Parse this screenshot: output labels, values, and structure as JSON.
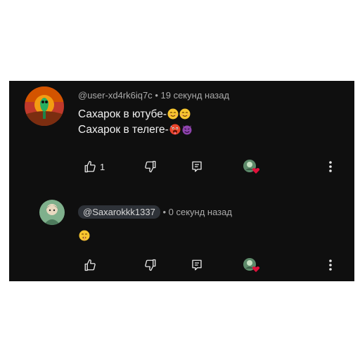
{
  "comments": [
    {
      "author": "@user-xd4rk6iq7c",
      "separator": "•",
      "time": "19 секунд назад",
      "lines": [
        "Сахарок в ютубе-",
        "Сахарок в телеге-"
      ],
      "line_emojis": [
        [
          "smiling-face-emoji",
          "smiling-face-emoji"
        ],
        [
          "hot-face-emoji",
          "purple-devil-emoji"
        ]
      ],
      "like_count": "1"
    },
    {
      "author": "@Saxarokkk1337",
      "separator": "•",
      "time": "0 секунд назад",
      "lines": [
        ""
      ],
      "line_emojis": [
        [
          "shushing-face-emoji"
        ]
      ],
      "like_count": ""
    }
  ],
  "colors": {
    "background": "#0f0f0f",
    "text": "#f1f1f1",
    "meta": "#aaaaaa",
    "handle_pill": "#2e3238",
    "heart": "#e0103a"
  },
  "icons": [
    "thumbs-up-icon",
    "thumbs-down-icon",
    "reply-icon",
    "creator-heart-icon",
    "more-vert-icon"
  ]
}
